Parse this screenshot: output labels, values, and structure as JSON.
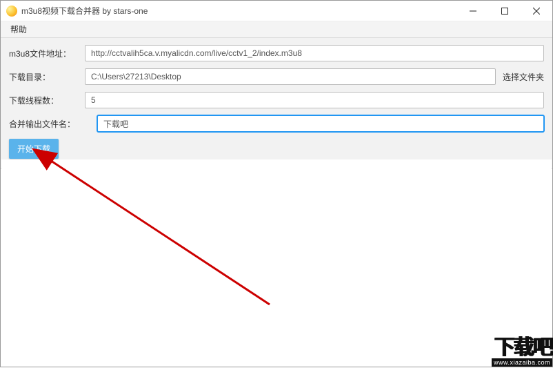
{
  "window": {
    "title": "m3u8视频下载合并器 by stars-one"
  },
  "menu": {
    "help": "帮助"
  },
  "form": {
    "url_label": "m3u8文件地址：",
    "url_value": "http://cctvalih5ca.v.myalicdn.com/live/cctv1_2/index.m3u8",
    "dir_label": "下载目录：",
    "dir_value": "C:\\Users\\27213\\Desktop",
    "choose_folder": "选择文件夹",
    "threads_label": "下载线程数：",
    "threads_value": "5",
    "output_label": "合并输出文件名：",
    "output_value": "下载吧",
    "start_button": "开始下载"
  },
  "watermark": {
    "text": "下载吧",
    "url": "www.xiazaiba.com"
  }
}
